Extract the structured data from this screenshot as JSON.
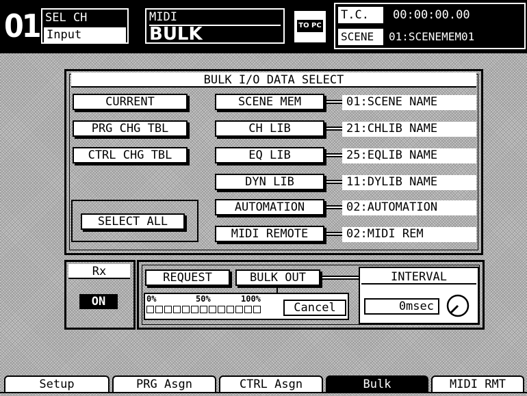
{
  "header": {
    "channel_number": "01",
    "sel_ch_label": "SEL CH",
    "sel_ch_value": "Input",
    "midi_label": "MIDI",
    "mode_value": "BULK",
    "to_pc_label": "TO PC",
    "tc_label": "T.C.",
    "tc_value": "00:00:00.00",
    "scene_label": "SCENE",
    "scene_value": "01:SCENEMEM01"
  },
  "bulk_select": {
    "title": "BULK I/O DATA SELECT",
    "left_buttons": [
      "CURRENT",
      "PRG CHG TBL",
      "CTRL CHG TBL"
    ],
    "select_all_label": "SELECT ALL",
    "items": [
      {
        "label": "SCENE MEM",
        "value": "01:SCENE NAME"
      },
      {
        "label": "CH LIB",
        "value": "21:CHLIB NAME"
      },
      {
        "label": "EQ LIB",
        "value": "25:EQLIB NAME"
      },
      {
        "label": "DYN LIB",
        "value": "11:DYLIB NAME"
      },
      {
        "label": "AUTOMATION",
        "value": "02:AUTOMATION"
      },
      {
        "label": "MIDI REMOTE",
        "value": "02:MIDI REM"
      }
    ]
  },
  "rx": {
    "label": "Rx",
    "state": "ON"
  },
  "transfer": {
    "request_label": "REQUEST",
    "bulk_out_label": "BULK OUT",
    "progress_labels": [
      "0%",
      "50%",
      "100%"
    ],
    "progress_fraction": 0,
    "cancel_label": "Cancel",
    "interval_label": "INTERVAL",
    "interval_value": "0msec"
  },
  "tabs": [
    {
      "label": "Setup",
      "active": false
    },
    {
      "label": "PRG Asgn",
      "active": false
    },
    {
      "label": "CTRL Asgn",
      "active": false
    },
    {
      "label": "Bulk",
      "active": true
    },
    {
      "label": "MIDI RMT",
      "active": false
    }
  ]
}
